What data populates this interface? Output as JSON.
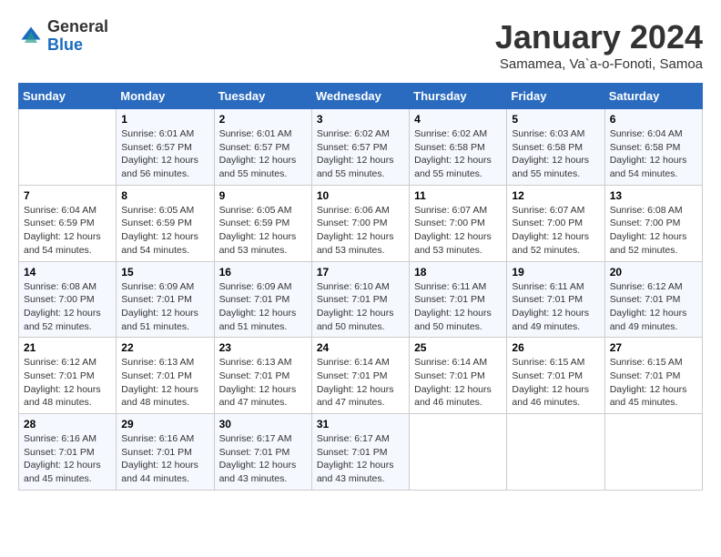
{
  "header": {
    "logo_general": "General",
    "logo_blue": "Blue",
    "title": "January 2024",
    "subtitle": "Samamea, Va`a-o-Fonoti, Samoa"
  },
  "weekdays": [
    "Sunday",
    "Monday",
    "Tuesday",
    "Wednesday",
    "Thursday",
    "Friday",
    "Saturday"
  ],
  "weeks": [
    [
      {
        "day": "",
        "sunrise": "",
        "sunset": "",
        "daylight": ""
      },
      {
        "day": "1",
        "sunrise": "Sunrise: 6:01 AM",
        "sunset": "Sunset: 6:57 PM",
        "daylight": "Daylight: 12 hours and 56 minutes."
      },
      {
        "day": "2",
        "sunrise": "Sunrise: 6:01 AM",
        "sunset": "Sunset: 6:57 PM",
        "daylight": "Daylight: 12 hours and 55 minutes."
      },
      {
        "day": "3",
        "sunrise": "Sunrise: 6:02 AM",
        "sunset": "Sunset: 6:57 PM",
        "daylight": "Daylight: 12 hours and 55 minutes."
      },
      {
        "day": "4",
        "sunrise": "Sunrise: 6:02 AM",
        "sunset": "Sunset: 6:58 PM",
        "daylight": "Daylight: 12 hours and 55 minutes."
      },
      {
        "day": "5",
        "sunrise": "Sunrise: 6:03 AM",
        "sunset": "Sunset: 6:58 PM",
        "daylight": "Daylight: 12 hours and 55 minutes."
      },
      {
        "day": "6",
        "sunrise": "Sunrise: 6:04 AM",
        "sunset": "Sunset: 6:58 PM",
        "daylight": "Daylight: 12 hours and 54 minutes."
      }
    ],
    [
      {
        "day": "7",
        "sunrise": "Sunrise: 6:04 AM",
        "sunset": "Sunset: 6:59 PM",
        "daylight": "Daylight: 12 hours and 54 minutes."
      },
      {
        "day": "8",
        "sunrise": "Sunrise: 6:05 AM",
        "sunset": "Sunset: 6:59 PM",
        "daylight": "Daylight: 12 hours and 54 minutes."
      },
      {
        "day": "9",
        "sunrise": "Sunrise: 6:05 AM",
        "sunset": "Sunset: 6:59 PM",
        "daylight": "Daylight: 12 hours and 53 minutes."
      },
      {
        "day": "10",
        "sunrise": "Sunrise: 6:06 AM",
        "sunset": "Sunset: 7:00 PM",
        "daylight": "Daylight: 12 hours and 53 minutes."
      },
      {
        "day": "11",
        "sunrise": "Sunrise: 6:07 AM",
        "sunset": "Sunset: 7:00 PM",
        "daylight": "Daylight: 12 hours and 53 minutes."
      },
      {
        "day": "12",
        "sunrise": "Sunrise: 6:07 AM",
        "sunset": "Sunset: 7:00 PM",
        "daylight": "Daylight: 12 hours and 52 minutes."
      },
      {
        "day": "13",
        "sunrise": "Sunrise: 6:08 AM",
        "sunset": "Sunset: 7:00 PM",
        "daylight": "Daylight: 12 hours and 52 minutes."
      }
    ],
    [
      {
        "day": "14",
        "sunrise": "Sunrise: 6:08 AM",
        "sunset": "Sunset: 7:00 PM",
        "daylight": "Daylight: 12 hours and 52 minutes."
      },
      {
        "day": "15",
        "sunrise": "Sunrise: 6:09 AM",
        "sunset": "Sunset: 7:01 PM",
        "daylight": "Daylight: 12 hours and 51 minutes."
      },
      {
        "day": "16",
        "sunrise": "Sunrise: 6:09 AM",
        "sunset": "Sunset: 7:01 PM",
        "daylight": "Daylight: 12 hours and 51 minutes."
      },
      {
        "day": "17",
        "sunrise": "Sunrise: 6:10 AM",
        "sunset": "Sunset: 7:01 PM",
        "daylight": "Daylight: 12 hours and 50 minutes."
      },
      {
        "day": "18",
        "sunrise": "Sunrise: 6:11 AM",
        "sunset": "Sunset: 7:01 PM",
        "daylight": "Daylight: 12 hours and 50 minutes."
      },
      {
        "day": "19",
        "sunrise": "Sunrise: 6:11 AM",
        "sunset": "Sunset: 7:01 PM",
        "daylight": "Daylight: 12 hours and 49 minutes."
      },
      {
        "day": "20",
        "sunrise": "Sunrise: 6:12 AM",
        "sunset": "Sunset: 7:01 PM",
        "daylight": "Daylight: 12 hours and 49 minutes."
      }
    ],
    [
      {
        "day": "21",
        "sunrise": "Sunrise: 6:12 AM",
        "sunset": "Sunset: 7:01 PM",
        "daylight": "Daylight: 12 hours and 48 minutes."
      },
      {
        "day": "22",
        "sunrise": "Sunrise: 6:13 AM",
        "sunset": "Sunset: 7:01 PM",
        "daylight": "Daylight: 12 hours and 48 minutes."
      },
      {
        "day": "23",
        "sunrise": "Sunrise: 6:13 AM",
        "sunset": "Sunset: 7:01 PM",
        "daylight": "Daylight: 12 hours and 47 minutes."
      },
      {
        "day": "24",
        "sunrise": "Sunrise: 6:14 AM",
        "sunset": "Sunset: 7:01 PM",
        "daylight": "Daylight: 12 hours and 47 minutes."
      },
      {
        "day": "25",
        "sunrise": "Sunrise: 6:14 AM",
        "sunset": "Sunset: 7:01 PM",
        "daylight": "Daylight: 12 hours and 46 minutes."
      },
      {
        "day": "26",
        "sunrise": "Sunrise: 6:15 AM",
        "sunset": "Sunset: 7:01 PM",
        "daylight": "Daylight: 12 hours and 46 minutes."
      },
      {
        "day": "27",
        "sunrise": "Sunrise: 6:15 AM",
        "sunset": "Sunset: 7:01 PM",
        "daylight": "Daylight: 12 hours and 45 minutes."
      }
    ],
    [
      {
        "day": "28",
        "sunrise": "Sunrise: 6:16 AM",
        "sunset": "Sunset: 7:01 PM",
        "daylight": "Daylight: 12 hours and 45 minutes."
      },
      {
        "day": "29",
        "sunrise": "Sunrise: 6:16 AM",
        "sunset": "Sunset: 7:01 PM",
        "daylight": "Daylight: 12 hours and 44 minutes."
      },
      {
        "day": "30",
        "sunrise": "Sunrise: 6:17 AM",
        "sunset": "Sunset: 7:01 PM",
        "daylight": "Daylight: 12 hours and 43 minutes."
      },
      {
        "day": "31",
        "sunrise": "Sunrise: 6:17 AM",
        "sunset": "Sunset: 7:01 PM",
        "daylight": "Daylight: 12 hours and 43 minutes."
      },
      {
        "day": "",
        "sunrise": "",
        "sunset": "",
        "daylight": ""
      },
      {
        "day": "",
        "sunrise": "",
        "sunset": "",
        "daylight": ""
      },
      {
        "day": "",
        "sunrise": "",
        "sunset": "",
        "daylight": ""
      }
    ]
  ]
}
